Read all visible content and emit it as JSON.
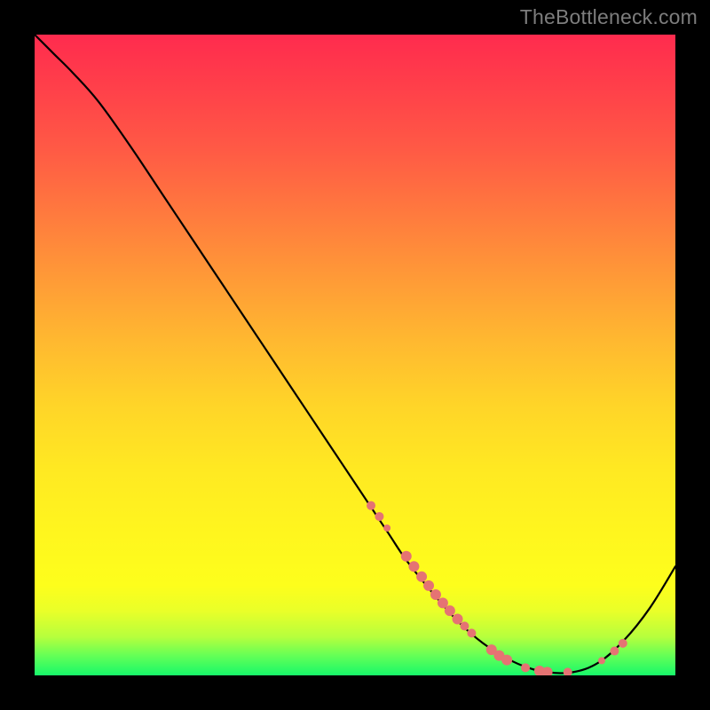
{
  "attribution": "TheBottleneck.com",
  "chart_data": {
    "type": "line",
    "title": "",
    "xlabel": "",
    "ylabel": "",
    "xlim": [
      0,
      100
    ],
    "ylim": [
      0,
      100
    ],
    "grid": false,
    "legend": false,
    "gradient_colors": {
      "top": "#ff2b4e",
      "mid": "#ffe922",
      "bottom": "#17f86a"
    },
    "series": [
      {
        "name": "bottleneck-curve",
        "color": "#000000",
        "x": [
          0,
          3,
          6,
          10,
          15,
          20,
          25,
          30,
          35,
          40,
          45,
          50,
          55,
          58,
          62,
          66,
          70,
          74,
          77,
          80,
          84,
          88,
          92,
          96,
          100
        ],
        "y": [
          100,
          97,
          94,
          89.5,
          82.5,
          75,
          67.5,
          60,
          52.5,
          45,
          37.5,
          30,
          22.5,
          18,
          13,
          8.5,
          5,
          2.5,
          1.2,
          0.5,
          0.5,
          2,
          5.5,
          10.5,
          17
        ]
      }
    ],
    "markers": [
      {
        "x": 52.5,
        "y": 26.5,
        "r": 5
      },
      {
        "x": 53.8,
        "y": 24.8,
        "r": 5
      },
      {
        "x": 55.0,
        "y": 23.0,
        "r": 4
      },
      {
        "x": 58.0,
        "y": 18.6,
        "r": 6
      },
      {
        "x": 59.2,
        "y": 17.0,
        "r": 6
      },
      {
        "x": 60.4,
        "y": 15.4,
        "r": 6
      },
      {
        "x": 61.5,
        "y": 14.0,
        "r": 6
      },
      {
        "x": 62.6,
        "y": 12.6,
        "r": 6
      },
      {
        "x": 63.7,
        "y": 11.3,
        "r": 6
      },
      {
        "x": 64.8,
        "y": 10.1,
        "r": 6
      },
      {
        "x": 66.0,
        "y": 8.8,
        "r": 6
      },
      {
        "x": 67.1,
        "y": 7.7,
        "r": 5
      },
      {
        "x": 68.2,
        "y": 6.6,
        "r": 5
      },
      {
        "x": 71.3,
        "y": 4.0,
        "r": 6
      },
      {
        "x": 72.5,
        "y": 3.1,
        "r": 6
      },
      {
        "x": 73.7,
        "y": 2.4,
        "r": 6
      },
      {
        "x": 76.6,
        "y": 1.2,
        "r": 5
      },
      {
        "x": 78.8,
        "y": 0.7,
        "r": 6
      },
      {
        "x": 80.0,
        "y": 0.5,
        "r": 6
      },
      {
        "x": 83.2,
        "y": 0.5,
        "r": 5
      },
      {
        "x": 88.5,
        "y": 2.3,
        "r": 4
      },
      {
        "x": 90.5,
        "y": 3.8,
        "r": 5
      },
      {
        "x": 91.8,
        "y": 5.0,
        "r": 5
      }
    ],
    "marker_style": {
      "fill": "#e57373",
      "stroke": "none"
    }
  }
}
